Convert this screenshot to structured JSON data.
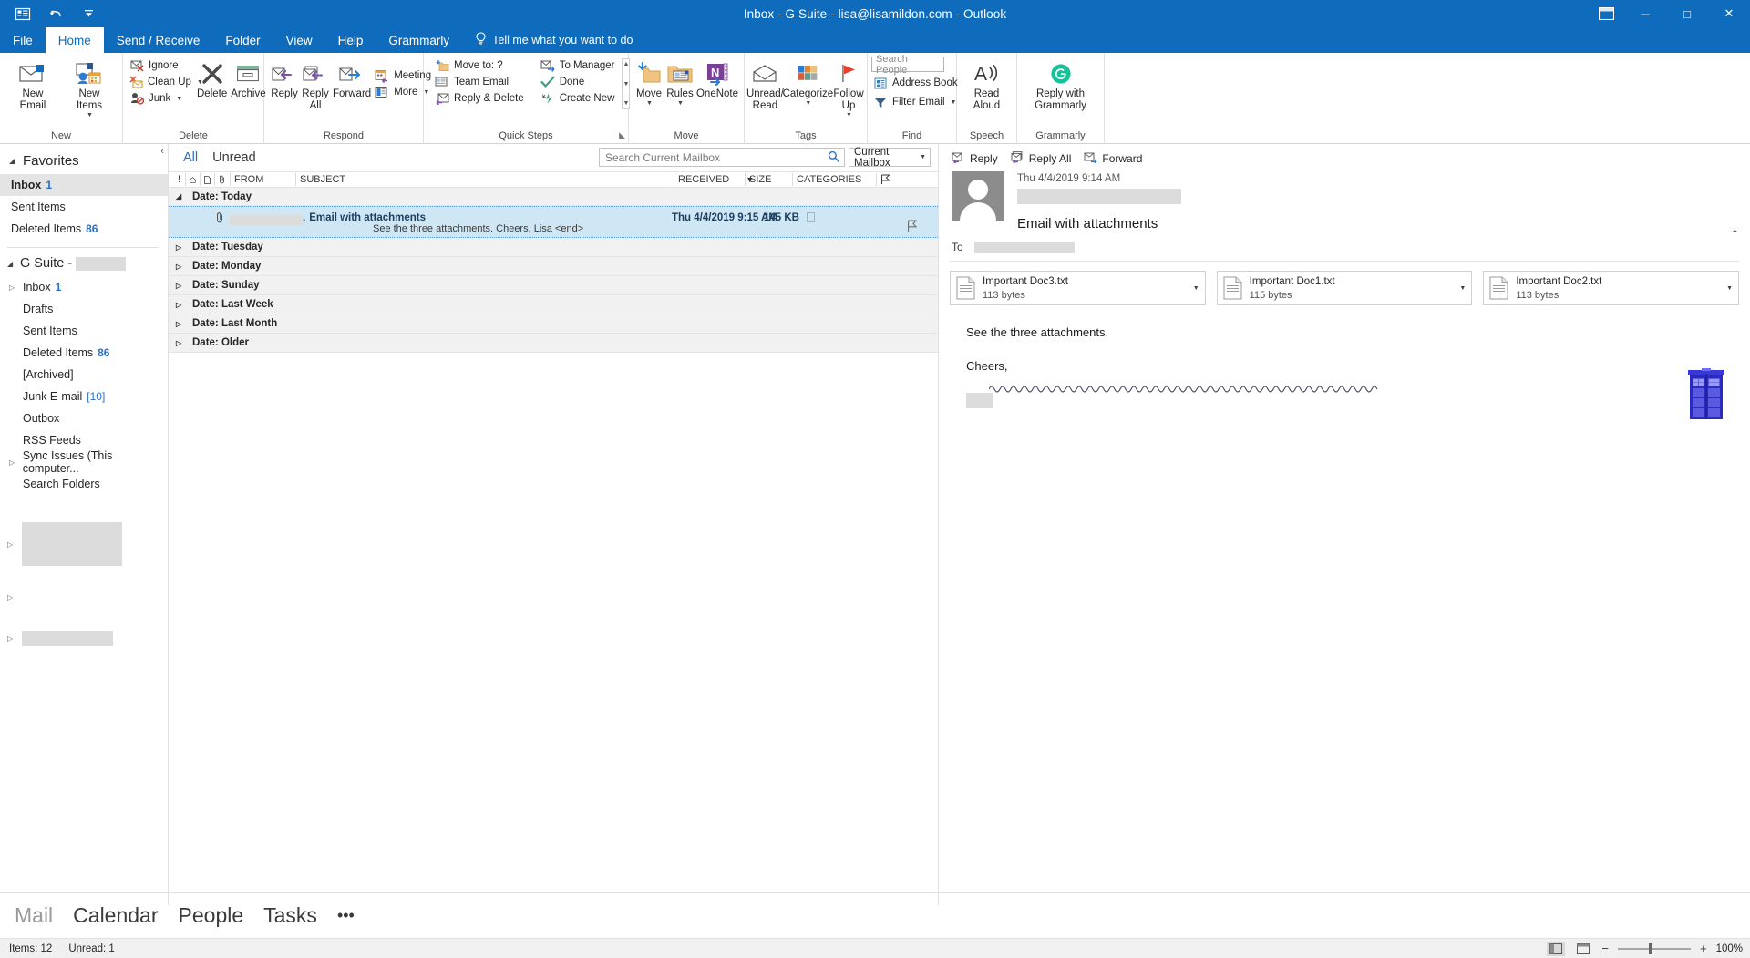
{
  "window": {
    "title": "Inbox - G Suite - lisa@lisamildon.com - Outlook",
    "quick_access": [
      {
        "name": "outlook-icon",
        "glyph": "☰"
      },
      {
        "name": "undo-icon",
        "glyph": "↶"
      },
      {
        "name": "customize-qat-icon",
        "glyph": "∴"
      }
    ],
    "controls": {
      "ribbon_display": "❐",
      "minimize": "─",
      "maximize": "□",
      "close": "✕"
    }
  },
  "tabs": [
    {
      "label": "File",
      "active": false
    },
    {
      "label": "Home",
      "active": true
    },
    {
      "label": "Send / Receive",
      "active": false
    },
    {
      "label": "Folder",
      "active": false
    },
    {
      "label": "View",
      "active": false
    },
    {
      "label": "Help",
      "active": false
    },
    {
      "label": "Grammarly",
      "active": false
    }
  ],
  "tell_me": "Tell me what you want to do",
  "ribbon": {
    "groups": [
      {
        "name": "New",
        "label": "New",
        "big_buttons": [
          {
            "label": "New\nEmail",
            "icon": "new-email-icon"
          },
          {
            "label": "New\nItems",
            "icon": "new-items-icon",
            "caret": true
          }
        ]
      },
      {
        "name": "Delete",
        "label": "Delete",
        "small_buttons": [
          {
            "label": "Ignore",
            "icon": "ignore-icon"
          },
          {
            "label": "Clean Up",
            "icon": "clean-up-icon",
            "caret": true
          },
          {
            "label": "Junk",
            "icon": "junk-icon",
            "caret": true
          }
        ],
        "big_buttons": [
          {
            "label": "Delete",
            "icon": "delete-icon"
          },
          {
            "label": "Archive",
            "icon": "archive-icon"
          }
        ]
      },
      {
        "name": "Respond",
        "label": "Respond",
        "big_buttons": [
          {
            "label": "Reply",
            "icon": "reply-icon"
          },
          {
            "label": "Reply\nAll",
            "icon": "reply-all-icon"
          },
          {
            "label": "Forward",
            "icon": "forward-icon"
          }
        ],
        "small_buttons": [
          {
            "label": "Meeting",
            "icon": "meeting-icon"
          },
          {
            "label": "More",
            "icon": "more-icon",
            "caret": true
          }
        ]
      },
      {
        "name": "Quick Steps",
        "label": "Quick Steps",
        "dialog_launcher": true,
        "items_col1": [
          {
            "label": "Move to: ?",
            "icon": "move-to-icon"
          },
          {
            "label": "Team Email",
            "icon": "team-email-icon"
          },
          {
            "label": "Reply & Delete",
            "icon": "reply-delete-icon"
          }
        ],
        "items_col2": [
          {
            "label": "To Manager",
            "icon": "to-manager-icon"
          },
          {
            "label": "Done",
            "icon": "done-icon"
          },
          {
            "label": "Create New",
            "icon": "create-new-icon"
          }
        ]
      },
      {
        "name": "Move",
        "label": "Move",
        "big_buttons": [
          {
            "label": "Move",
            "icon": "move-icon",
            "caret": true
          },
          {
            "label": "Rules",
            "icon": "rules-icon",
            "caret": true
          },
          {
            "label": "OneNote",
            "icon": "onenote-icon"
          }
        ]
      },
      {
        "name": "Tags",
        "label": "Tags",
        "big_buttons": [
          {
            "label": "Unread/\nRead",
            "icon": "unread-read-icon"
          },
          {
            "label": "Categorize",
            "icon": "categorize-icon",
            "caret": true
          },
          {
            "label": "Follow\nUp",
            "icon": "follow-up-icon",
            "caret": true
          }
        ]
      },
      {
        "name": "Find",
        "label": "Find",
        "search_people_placeholder": "Search People",
        "items": [
          {
            "label": "Address Book",
            "icon": "address-book-icon"
          },
          {
            "label": "Filter Email",
            "icon": "filter-email-icon",
            "caret": true
          }
        ]
      },
      {
        "name": "Speech",
        "label": "Speech",
        "big_buttons": [
          {
            "label": "Read\nAloud",
            "icon": "read-aloud-icon"
          }
        ]
      },
      {
        "name": "Grammarly",
        "label": "Grammarly",
        "big_buttons": [
          {
            "label": "Reply with\nGrammarly",
            "icon": "grammarly-icon"
          }
        ]
      }
    ]
  },
  "folder_pane": {
    "favorites_header": "Favorites",
    "favorites": [
      {
        "label": "Inbox",
        "count": "1",
        "selected": true
      },
      {
        "label": "Sent Items",
        "count": "",
        "selected": false
      },
      {
        "label": "Deleted Items",
        "count": "86",
        "selected": false
      }
    ],
    "account_header": "G Suite -",
    "account_redacted": true,
    "folders": [
      {
        "label": "Inbox",
        "count": "1",
        "expandable": true
      },
      {
        "label": "Drafts",
        "count": ""
      },
      {
        "label": "Sent Items",
        "count": ""
      },
      {
        "label": "Deleted Items",
        "count": "86"
      },
      {
        "label": "[Archived]",
        "count": ""
      },
      {
        "label": "Junk E-mail",
        "count": "[10]",
        "bracket": true
      },
      {
        "label": "Outbox",
        "count": ""
      },
      {
        "label": "RSS Feeds",
        "count": ""
      },
      {
        "label": "Sync Issues (This computer...",
        "count": "",
        "expandable": true
      },
      {
        "label": "Search Folders",
        "count": ""
      }
    ],
    "ghost_accounts": 3
  },
  "message_list": {
    "filter_tabs": [
      {
        "label": "All",
        "active": true
      },
      {
        "label": "Unread",
        "active": false
      }
    ],
    "search_placeholder": "Search Current Mailbox",
    "search_scope": "Current Mailbox",
    "columns": [
      {
        "label": "!",
        "name": "importance-column"
      },
      {
        "label": "⌂",
        "name": "reminder-column"
      },
      {
        "label": "὜b",
        "name": "icon-column"
      },
      {
        "label": "@",
        "name": "attachment-column"
      },
      {
        "label": "FROM",
        "name": "from-column"
      },
      {
        "label": "SUBJECT",
        "name": "subject-column"
      },
      {
        "label": "RECEIVED",
        "name": "received-column",
        "sorted": true
      },
      {
        "label": "SIZE",
        "name": "size-column"
      },
      {
        "label": "CATEGORIES",
        "name": "categories-column"
      }
    ],
    "groups": [
      {
        "label": "Date: Today",
        "expanded": true,
        "messages": [
          {
            "from_redacted": true,
            "subject": "Email with attachments",
            "preview": "See the three attachments.   Cheers,   Lisa <end>",
            "received": "Thu 4/4/2019 9:15 AM",
            "size": "145 KB",
            "has_attachment": true,
            "selected": true
          }
        ]
      },
      {
        "label": "Date: Tuesday",
        "expanded": false,
        "messages": []
      },
      {
        "label": "Date: Monday",
        "expanded": false,
        "messages": []
      },
      {
        "label": "Date: Sunday",
        "expanded": false,
        "messages": []
      },
      {
        "label": "Date: Last Week",
        "expanded": false,
        "messages": []
      },
      {
        "label": "Date: Last Month",
        "expanded": false,
        "messages": []
      },
      {
        "label": "Date: Older",
        "expanded": false,
        "messages": []
      }
    ]
  },
  "reading_pane": {
    "actions": [
      {
        "label": "Reply",
        "icon": "reply-icon"
      },
      {
        "label": "Reply All",
        "icon": "reply-all-icon"
      },
      {
        "label": "Forward",
        "icon": "forward-icon"
      }
    ],
    "date": "Thu 4/4/2019 9:14 AM",
    "sender_redacted": true,
    "subject": "Email with attachments",
    "to_label": "To",
    "to_redacted": true,
    "attachments": [
      {
        "name": "Important Doc3.txt",
        "size": "113 bytes"
      },
      {
        "name": "Important Doc1.txt",
        "size": "115 bytes"
      },
      {
        "name": "Important Doc2.txt",
        "size": "113 bytes"
      }
    ],
    "body_paragraphs": [
      "See the three attachments.",
      "Cheers,"
    ],
    "signature_redacted": true
  },
  "bottom_nav": [
    {
      "label": "Mail",
      "active": true
    },
    {
      "label": "Calendar",
      "active": false
    },
    {
      "label": "People",
      "active": false
    },
    {
      "label": "Tasks",
      "active": false
    },
    {
      "label": "•••",
      "active": false
    }
  ],
  "status_bar": {
    "items_count": "Items: 12",
    "unread_count": "Unread: 1",
    "zoom_level": "100%",
    "zoom_minus": "−",
    "zoom_plus": "+"
  },
  "colors": {
    "brand": "#0f6cbd",
    "selection": "#cfe7f5",
    "accent_link": "#2a6fc2",
    "grammarly_green": "#15c39a"
  }
}
